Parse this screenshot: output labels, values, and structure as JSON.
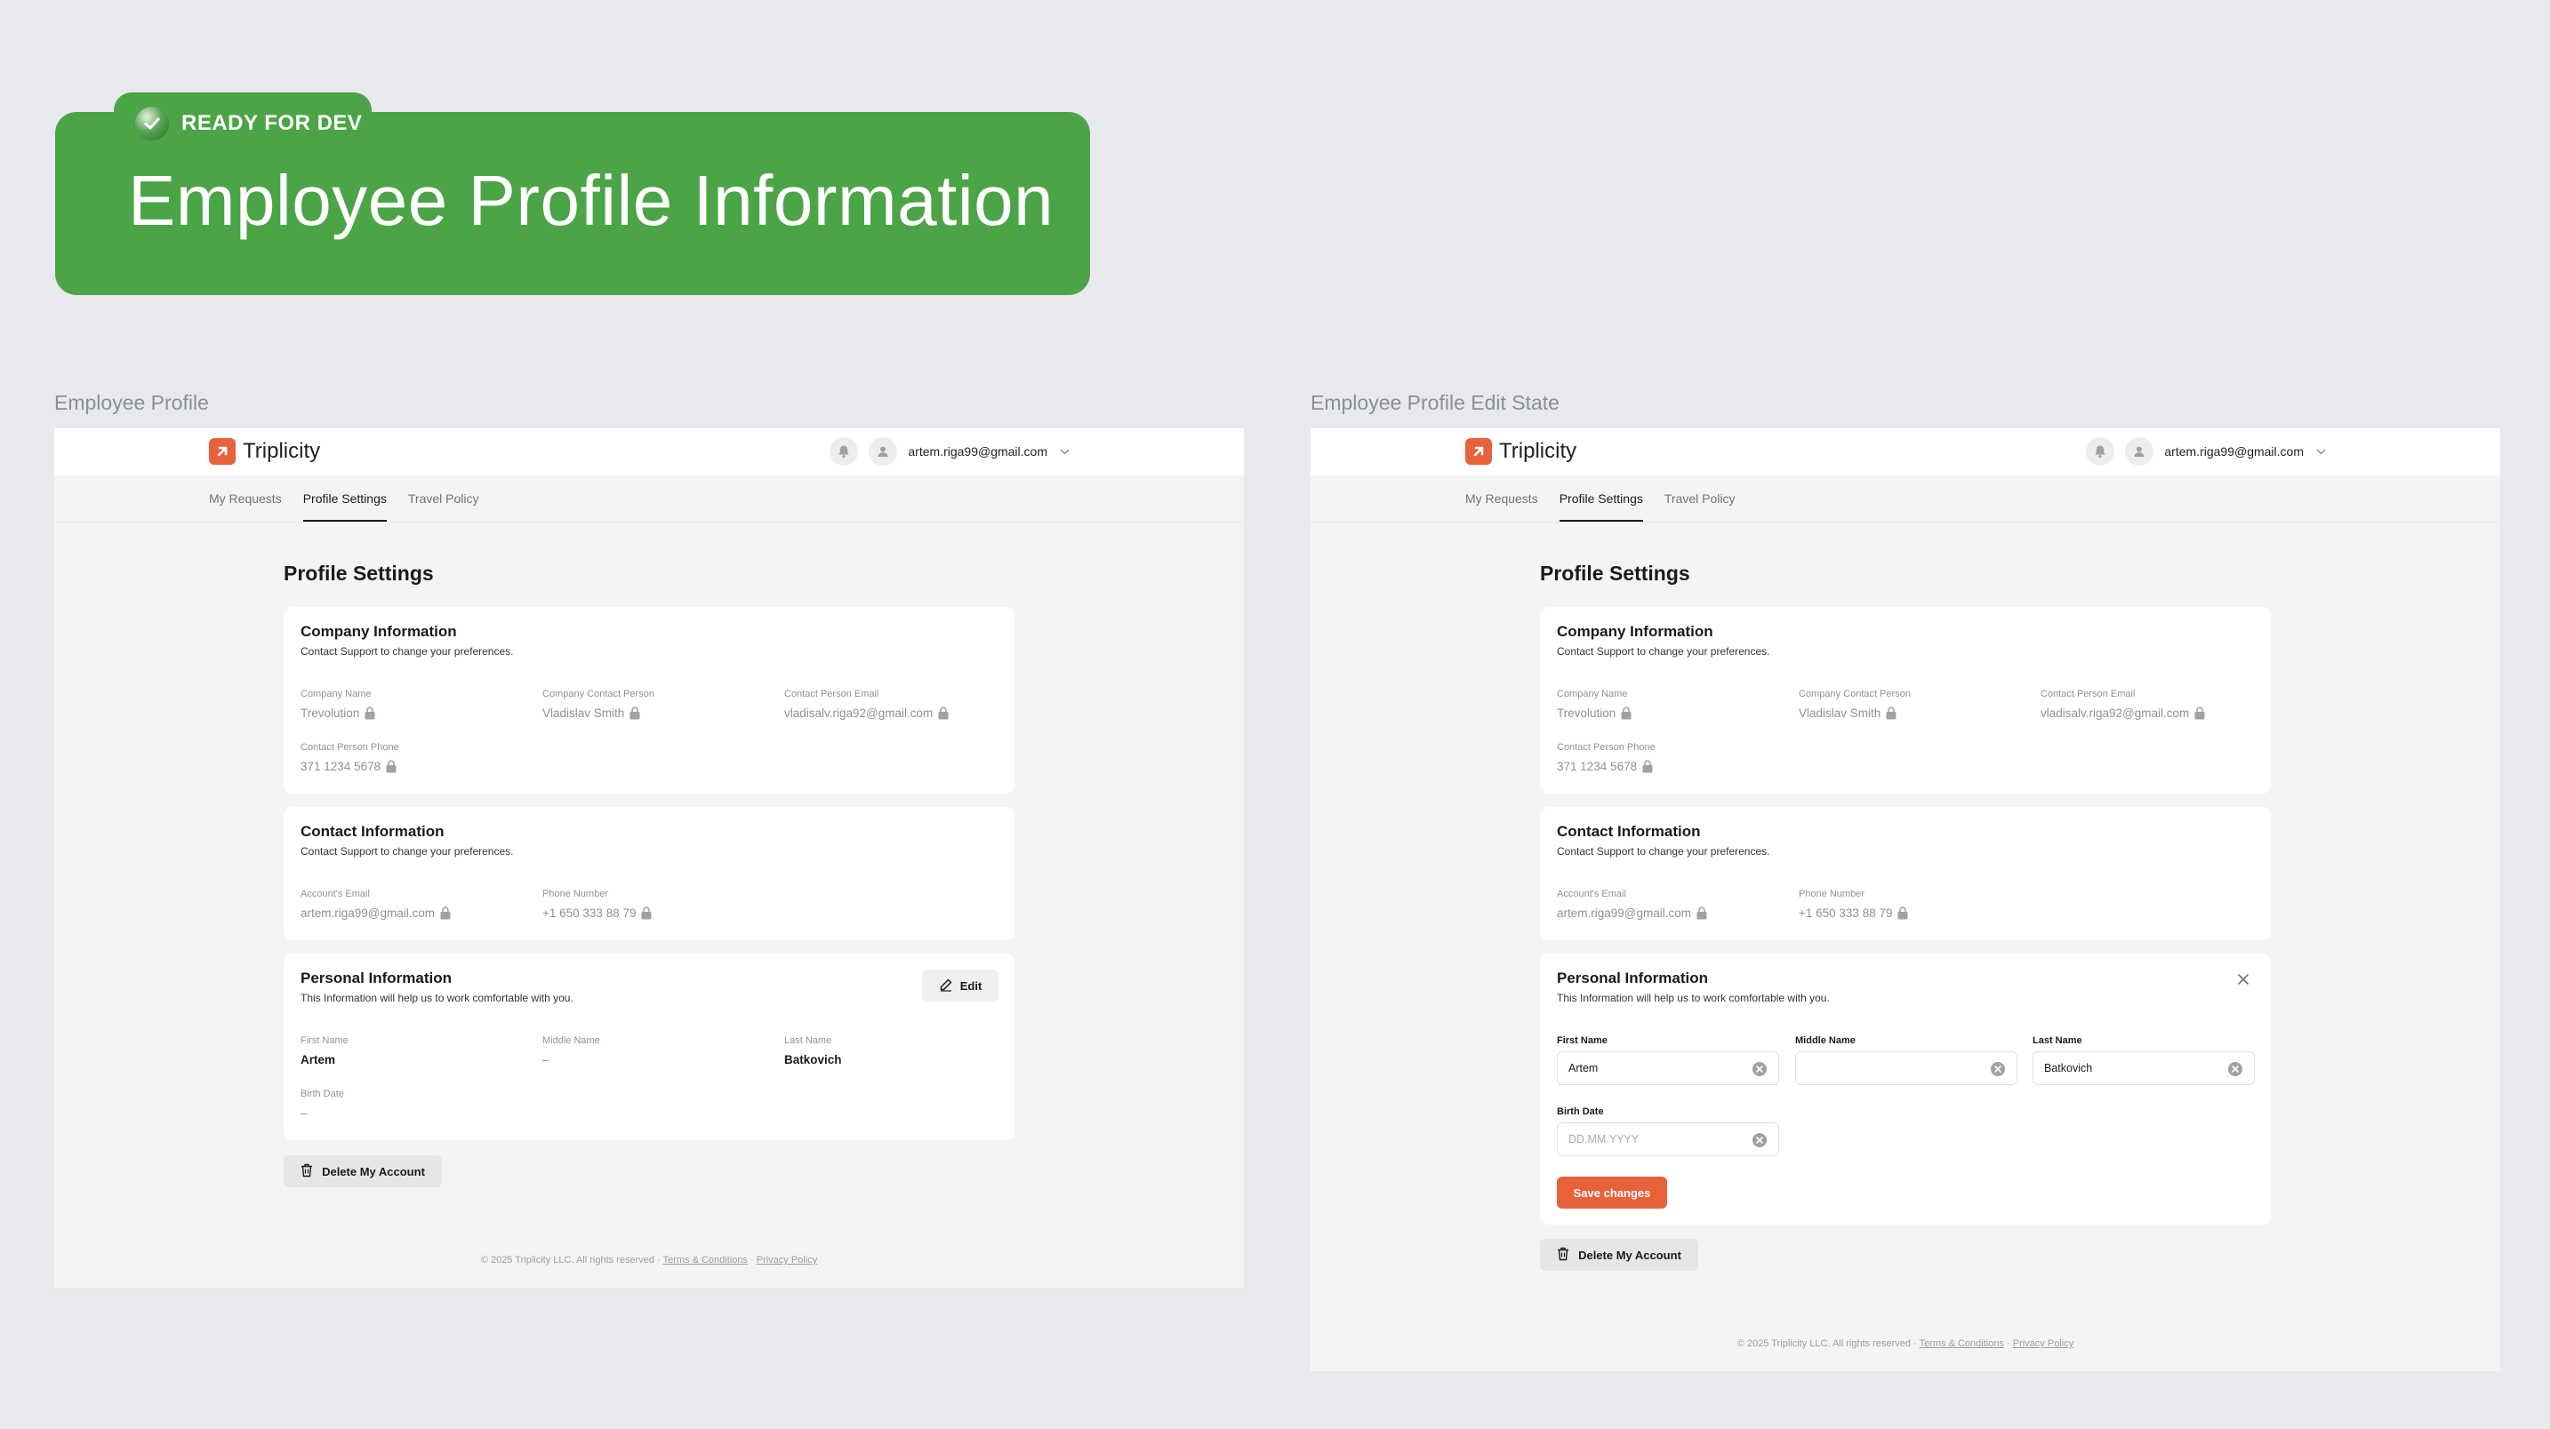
{
  "banner": {
    "status": "READY FOR DEV",
    "title": "Employee Profile Information",
    "color": "#4ba446"
  },
  "colors": {
    "accent": "#e8613a",
    "banner": "#4ba446"
  },
  "frames": {
    "left_label": "Employee Profile",
    "right_label": "Employee Profile Edit State"
  },
  "app": {
    "name": "Triplicity",
    "logo_icon": "arrow-up-right-icon",
    "user_email": "artem.riga99@gmail.com",
    "tabs": [
      "My Requests",
      "Profile Settings",
      "Travel Policy"
    ],
    "active_tab": "Profile Settings",
    "page_title": "Profile Settings"
  },
  "company": {
    "title": "Company Information",
    "subtitle": "Contact Support to change your preferences.",
    "fields": [
      {
        "label": "Company Name",
        "value": "Trevolution"
      },
      {
        "label": "Company Contact Person",
        "value": "Vladislav Smith"
      },
      {
        "label": "Contact Person Email",
        "value": "vladisalv.riga92@gmail.com"
      },
      {
        "label": "Contact Person Phone",
        "value": "371 1234 5678"
      }
    ]
  },
  "contact": {
    "title": "Contact Information",
    "subtitle": "Contact Support to change your preferences.",
    "fields": [
      {
        "label": "Account's Email",
        "value": "artem.riga99@gmail.com"
      },
      {
        "label": "Phone Number",
        "value": "+1 650 333 88 79"
      }
    ]
  },
  "personal": {
    "title": "Personal Information",
    "subtitle": "This Information will help us to work comfortable with you.",
    "edit_label": "Edit",
    "fields": [
      {
        "label": "First Name",
        "value": "Artem"
      },
      {
        "label": "Middle Name",
        "value": "–"
      },
      {
        "label": "Last Name",
        "value": "Batkovich"
      },
      {
        "label": "Birth Date",
        "value": "–"
      }
    ],
    "edit_fields": [
      {
        "label": "First Name",
        "value": "Artem"
      },
      {
        "label": "Middle Name",
        "value": ""
      },
      {
        "label": "Last Name",
        "value": "Batkovich"
      },
      {
        "label": "Birth Date",
        "value": "",
        "placeholder": "DD.MM.YYYY"
      }
    ],
    "save_label": "Save changes"
  },
  "delete_label": "Delete My Account",
  "footer": {
    "copyright": "© 2025 Triplicity LLC. All rights reserved ·",
    "terms": "Terms & Conditions",
    "sep": "·",
    "privacy": "Privacy Policy"
  }
}
